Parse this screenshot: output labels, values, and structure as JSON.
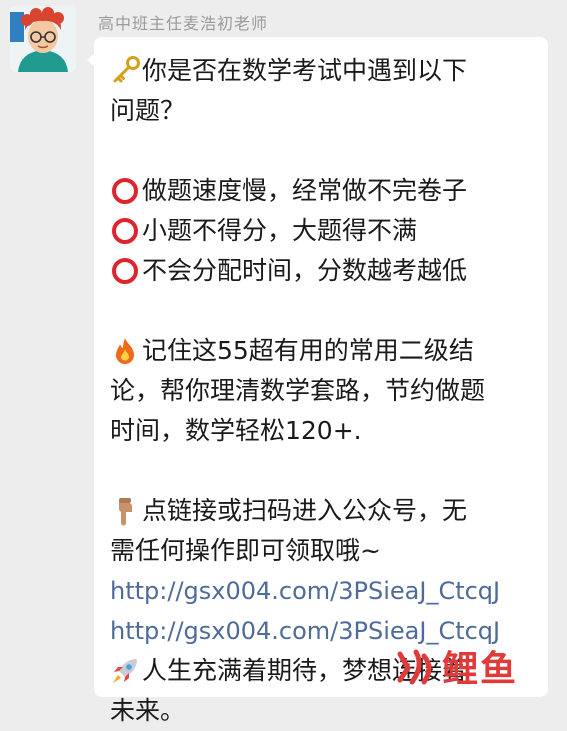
{
  "chat": {
    "sender_name": "高中班主任麦浩初老师",
    "lines": [
      {
        "icon": "key-icon",
        "text": "你是否在数学考试中遇到以下"
      },
      {
        "icon": "",
        "text": "问题？"
      },
      {
        "icon": "",
        "text": ""
      },
      {
        "icon": "red-circle-icon",
        "text": "做题速度慢，经常做不完卷子"
      },
      {
        "icon": "red-circle-icon",
        "text": "小题不得分，大题得不满"
      },
      {
        "icon": "red-circle-icon",
        "text": "不会分配时间，分数越考越低"
      },
      {
        "icon": "",
        "text": ""
      },
      {
        "icon": "fire-icon",
        "text": "记住这55超有用的常用二级结"
      },
      {
        "icon": "",
        "text": "论，帮你理清数学套路，节约做题"
      },
      {
        "icon": "",
        "text": "时间，数学轻松120+."
      },
      {
        "icon": "",
        "text": ""
      },
      {
        "icon": "pointing-down-icon",
        "text": "点链接或扫码进入公众号，无"
      },
      {
        "icon": "",
        "text": "需任何操作即可领取哦~"
      },
      {
        "icon": "",
        "text": "http://gsx004.com/3PSieaJ_CtcqJ",
        "link": true
      },
      {
        "icon": "",
        "text": "http://gsx004.com/3PSieaJ_CtcqJ",
        "link": true
      },
      {
        "icon": "rocket-icon",
        "text": "人生充满着期待，梦想连接着"
      },
      {
        "icon": "",
        "text": "未来。"
      }
    ]
  },
  "watermark": {
    "text": "鲤鱼"
  },
  "colors": {
    "background": "#ededed",
    "bubble": "#ffffff",
    "link": "#4f6b9a",
    "watermark": "#e03a3a"
  }
}
